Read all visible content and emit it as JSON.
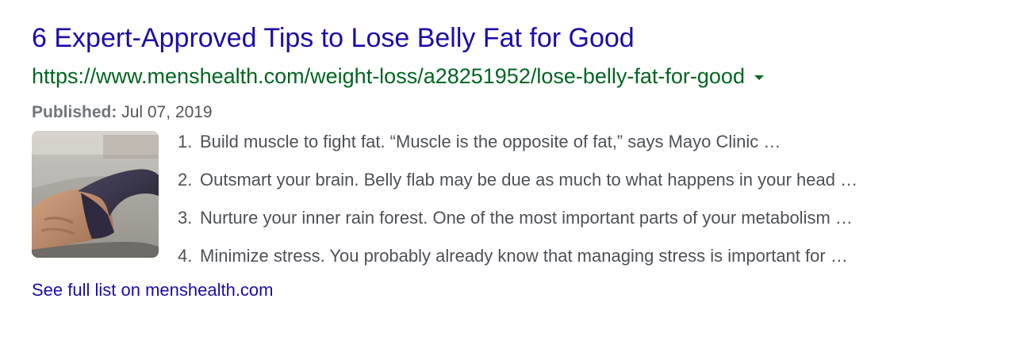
{
  "result": {
    "title": "6 Expert-Approved Tips to Lose Belly Fat for Good",
    "url": "https://www.menshealth.com/weight-loss/a28251952/lose-belly-fat-for-good",
    "published_label": "Published:",
    "published_date": "Jul 07, 2019",
    "list_items": [
      {
        "number": "1.",
        "text": "Build muscle to fight fat. “Muscle is the opposite of fat,” says Mayo Clinic …"
      },
      {
        "number": "2.",
        "text": "Outsmart your brain. Belly flab may be due as much to what happens in your head …"
      },
      {
        "number": "3.",
        "text": "Nurture your inner rain forest. One of the most important parts of your metabolism …"
      },
      {
        "number": "4.",
        "text": "Minimize stress. You probably already know that managing stress is important for …"
      }
    ],
    "see_more": "See full list on menshealth.com"
  },
  "icons": {
    "dropdown": "caret-down-icon"
  },
  "colors": {
    "title": "#1a0dab",
    "url": "#006621",
    "snippet": "#4d5156",
    "meta_label": "#70757a"
  }
}
